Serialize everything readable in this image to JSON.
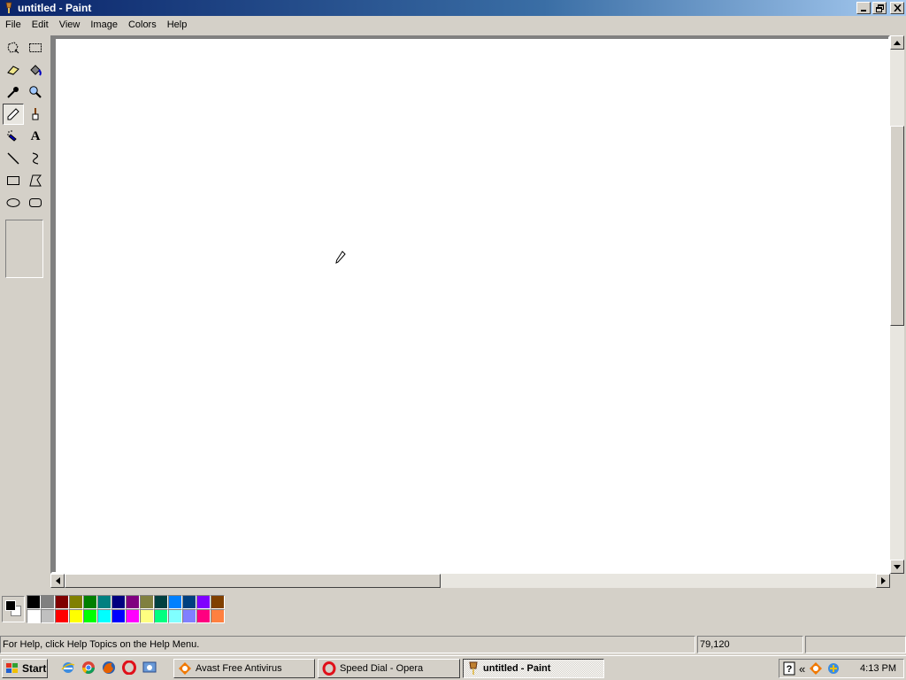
{
  "window": {
    "title": "untitled - Paint"
  },
  "menu": [
    "File",
    "Edit",
    "View",
    "Image",
    "Colors",
    "Help"
  ],
  "tools": [
    {
      "name": "free-form-select"
    },
    {
      "name": "select"
    },
    {
      "name": "eraser"
    },
    {
      "name": "fill-with-color"
    },
    {
      "name": "pick-color"
    },
    {
      "name": "magnifier"
    },
    {
      "name": "pencil",
      "active": true
    },
    {
      "name": "brush"
    },
    {
      "name": "airbrush"
    },
    {
      "name": "text",
      "glyph": "A"
    },
    {
      "name": "line"
    },
    {
      "name": "curve"
    },
    {
      "name": "rectangle"
    },
    {
      "name": "polygon"
    },
    {
      "name": "ellipse"
    },
    {
      "name": "rounded-rectangle"
    }
  ],
  "colors": {
    "foreground": "#000000",
    "background": "#ffffff",
    "palette_top": [
      "#000000",
      "#808080",
      "#800000",
      "#808000",
      "#008000",
      "#008080",
      "#000080",
      "#800080",
      "#808040",
      "#004040",
      "#0080ff",
      "#004080",
      "#8000ff",
      "#804000"
    ],
    "palette_bottom": [
      "#ffffff",
      "#c0c0c0",
      "#ff0000",
      "#ffff00",
      "#00ff00",
      "#00ffff",
      "#0000ff",
      "#ff00ff",
      "#ffff80",
      "#00ff80",
      "#80ffff",
      "#8080ff",
      "#ff0080",
      "#ff8040"
    ]
  },
  "status": {
    "help": "For Help, click Help Topics on the Help Menu.",
    "coords": "79,120",
    "size": ""
  },
  "taskbar": {
    "start": "Start",
    "quick_launch": [
      "internet-explorer-icon",
      "chrome-icon",
      "firefox-icon",
      "opera-icon",
      "show-desktop-icon"
    ],
    "tasks": [
      {
        "label": "Avast Free Antivirus",
        "icon": "avast-icon"
      },
      {
        "label": "Speed Dial - Opera",
        "icon": "opera-icon"
      },
      {
        "label": "untitled - Paint",
        "icon": "paint-icon",
        "active": true
      }
    ],
    "tray_chevron": "«",
    "clock": "4:13 PM"
  }
}
